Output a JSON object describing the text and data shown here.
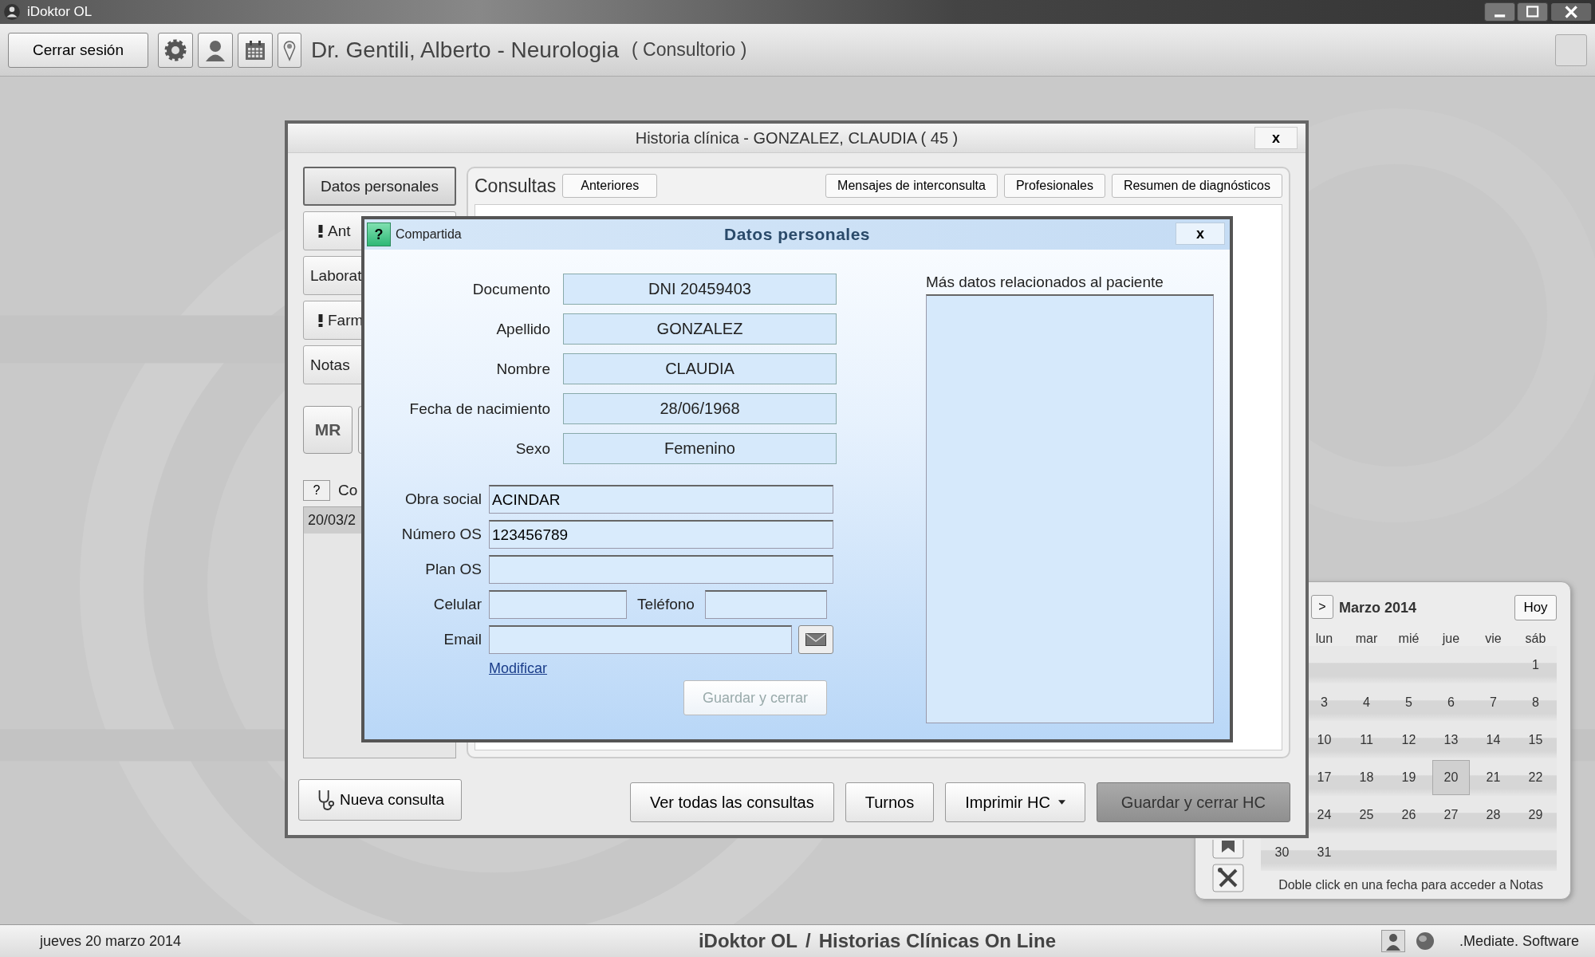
{
  "app": {
    "title": "iDoktor OL"
  },
  "toolbar": {
    "logout": "Cerrar sesión",
    "doctor": "Dr. Gentili, Alberto - Neurologia",
    "location": "( Consultorio )"
  },
  "record_window": {
    "title": "Historia clínica - GONZALEZ, CLAUDIA ( 45 )",
    "close": "x",
    "sections": [
      {
        "label": "Datos personales",
        "selected": true,
        "flagged": false
      },
      {
        "label": "Ant",
        "selected": false,
        "flagged": true
      },
      {
        "label": "Laborat",
        "selected": false,
        "flagged": false
      },
      {
        "label": "Farm",
        "selected": false,
        "flagged": true
      },
      {
        "label": "Notas",
        "selected": false,
        "flagged": false
      }
    ],
    "mr_button": "MR",
    "help": "?",
    "consultas_label": "Co",
    "consultas": [
      {
        "date": "20/03/2",
        "selected": true
      }
    ],
    "new_consult": "Nueva consulta",
    "panel": {
      "title": "Consultas",
      "tabs": [
        "Anteriores",
        "Mensajes de interconsulta",
        "Profesionales",
        "Resumen de diagnósticos"
      ]
    },
    "actions": [
      {
        "label": "Ver todas las consultas",
        "kind": "button"
      },
      {
        "label": "Turnos",
        "kind": "button"
      },
      {
        "label": "Imprimir HC",
        "kind": "dropdown"
      },
      {
        "label": "Guardar y cerrar HC",
        "kind": "primary"
      }
    ]
  },
  "dialog": {
    "help": "?",
    "shared": "Compartida",
    "title": "Datos personales",
    "close": "x",
    "identity": [
      {
        "label": "Documento",
        "value": "DNI 20459403"
      },
      {
        "label": "Apellido",
        "value": "GONZALEZ"
      },
      {
        "label": "Nombre",
        "value": "CLAUDIA"
      },
      {
        "label": "Fecha de nacimiento",
        "value": "28/06/1968"
      },
      {
        "label": "Sexo",
        "value": "Femenino"
      }
    ],
    "coverage": [
      {
        "label": "Obra social",
        "value": "ACINDAR"
      },
      {
        "label": "Número OS",
        "value": "123456789"
      },
      {
        "label": "Plan OS"
      }
    ],
    "celular": {
      "label": "Celular"
    },
    "telefono": {
      "label": "Teléfono"
    },
    "email": {
      "label": "Email"
    },
    "modify_link": "Modificar",
    "save": {
      "label": "Guardar y cerrar",
      "disabled": true
    },
    "notes": {
      "label": "Más datos relacionados al paciente"
    }
  },
  "calendar": {
    "next": ">",
    "month": "Marzo 2014",
    "today": "Hoy",
    "weekdays": [
      "lun",
      "mar",
      "mié",
      "jue",
      "vie",
      "sáb"
    ],
    "weeks": [
      {
        "days": [
          {
            "day": "1",
            "selected": false
          }
        ]
      },
      {
        "days": [
          {
            "day": "3",
            "selected": false
          },
          {
            "day": "4",
            "selected": false
          },
          {
            "day": "5",
            "selected": false
          },
          {
            "day": "6",
            "selected": false
          },
          {
            "day": "7",
            "selected": false
          },
          {
            "day": "8",
            "selected": false
          }
        ]
      },
      {
        "days": [
          {
            "day": "10",
            "selected": false
          },
          {
            "day": "11",
            "selected": false
          },
          {
            "day": "12",
            "selected": false
          },
          {
            "day": "13",
            "selected": false
          },
          {
            "day": "14",
            "selected": false
          },
          {
            "day": "15",
            "selected": false
          }
        ]
      },
      {
        "days": [
          {
            "day": "17",
            "selected": false
          },
          {
            "day": "18",
            "selected": false
          },
          {
            "day": "19",
            "selected": false
          },
          {
            "day": "20",
            "selected": true
          },
          {
            "day": "21",
            "selected": false
          },
          {
            "day": "22",
            "selected": false
          }
        ]
      },
      {
        "days": [
          {
            "day": "24",
            "selected": false
          },
          {
            "day": "25",
            "selected": false
          },
          {
            "day": "26",
            "selected": false
          },
          {
            "day": "27",
            "selected": false
          },
          {
            "day": "28",
            "selected": false
          },
          {
            "day": "29",
            "selected": false
          }
        ]
      },
      {
        "days": [
          {
            "day": "30",
            "selected": false
          },
          {
            "day": "31",
            "selected": false
          }
        ]
      }
    ],
    "hint": "Doble click en una fecha para acceder a Notas"
  },
  "status_bar": {
    "date": "jueves 20 marzo 2014",
    "product": "iDoktor OL",
    "separator": "/",
    "subtitle": "Historias Clínicas On Line",
    "vendor": ".Mediate. Software"
  }
}
